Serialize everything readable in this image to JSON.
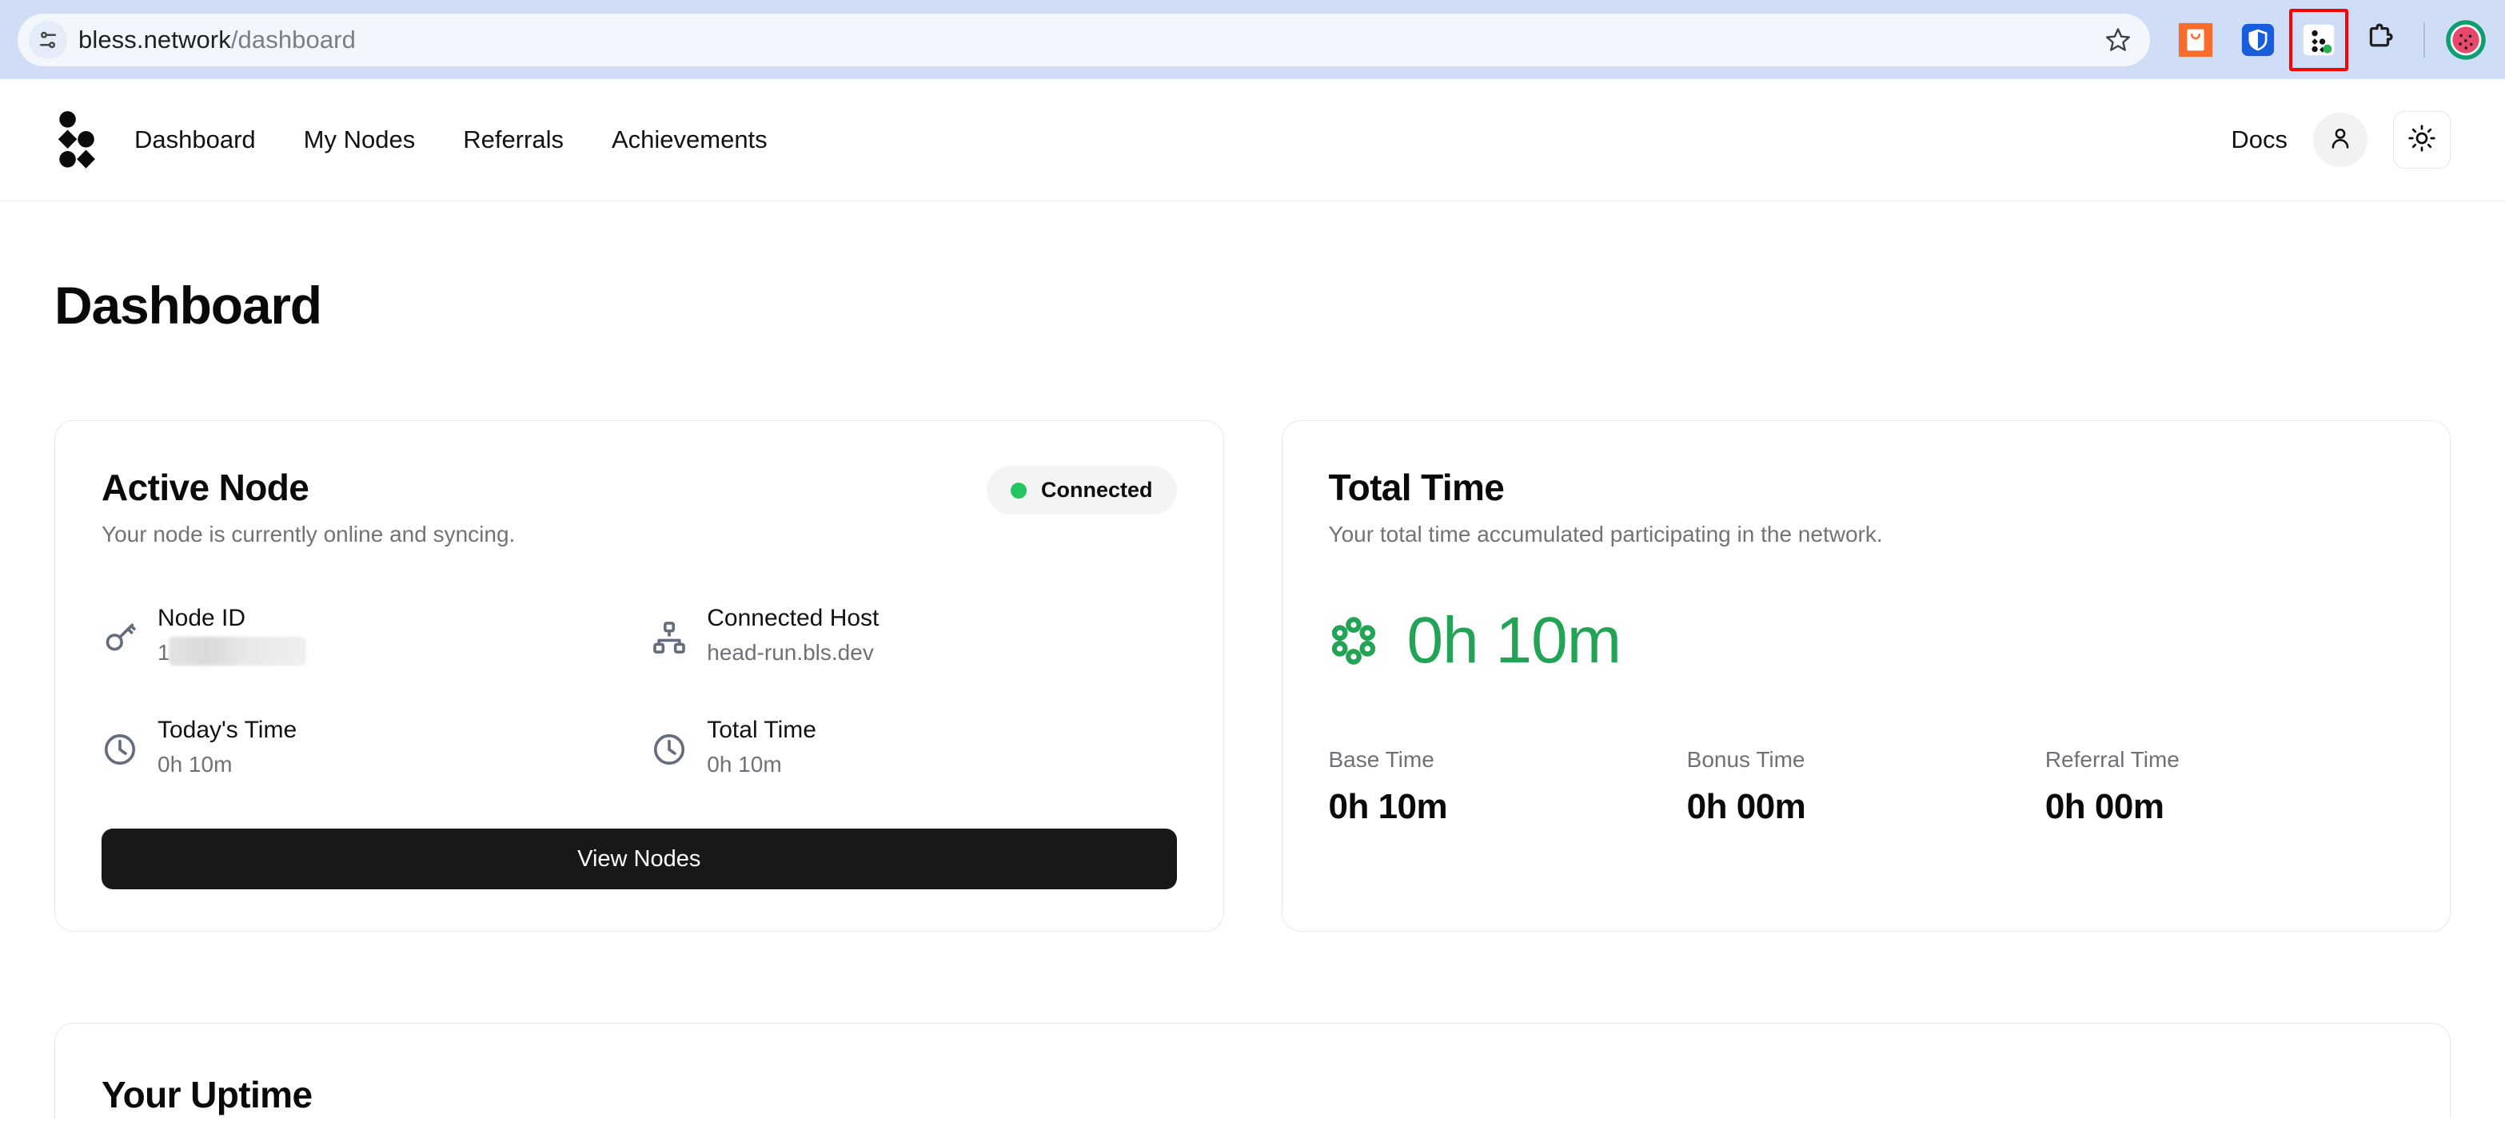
{
  "browser": {
    "url_domain": "bless.network",
    "url_path": "/dashboard",
    "icons": {
      "page_info": "tune-icon",
      "bookmark": "star-icon",
      "ext_orange": "shopping-bag-extension-icon",
      "ext_shield": "password-manager-shield-icon",
      "ext_bless": "bless-network-extension-icon",
      "ext_puzzle": "extensions-puzzle-icon",
      "profile": "watermelon-profile-avatar"
    }
  },
  "header": {
    "logo": "bless-logo-icon",
    "nav": [
      {
        "label": "Dashboard"
      },
      {
        "label": "My Nodes"
      },
      {
        "label": "Referrals"
      },
      {
        "label": "Achievements"
      }
    ],
    "docs_label": "Docs",
    "account_icon": "user-account-icon",
    "theme_icon": "sun-theme-toggle-icon"
  },
  "page": {
    "title": "Dashboard"
  },
  "active_node": {
    "title": "Active Node",
    "subtitle": "Your node is currently online and syncing.",
    "status": {
      "label": "Connected",
      "color": "#22c55e"
    },
    "details": [
      {
        "icon": "key-icon",
        "label": "Node ID",
        "value": "1",
        "redacted": true
      },
      {
        "icon": "network-icon",
        "label": "Connected Host",
        "value": "head-run.bls.dev",
        "redacted": false
      },
      {
        "icon": "clock-icon",
        "label": "Today's Time",
        "value": "0h 10m",
        "redacted": false
      },
      {
        "icon": "clock-icon",
        "label": "Total Time",
        "value": "0h 10m",
        "redacted": false
      }
    ],
    "button_label": "View Nodes"
  },
  "total_time": {
    "title": "Total Time",
    "subtitle": "Your total time accumulated participating in the network.",
    "icon": "bless-nodes-ring-icon",
    "value": "0h 10m",
    "value_color": "#22a355",
    "breakdown": [
      {
        "label": "Base Time",
        "value": "0h 10m"
      },
      {
        "label": "Bonus Time",
        "value": "0h 00m"
      },
      {
        "label": "Referral Time",
        "value": "0h 00m"
      }
    ]
  },
  "uptime": {
    "title": "Your Uptime"
  }
}
